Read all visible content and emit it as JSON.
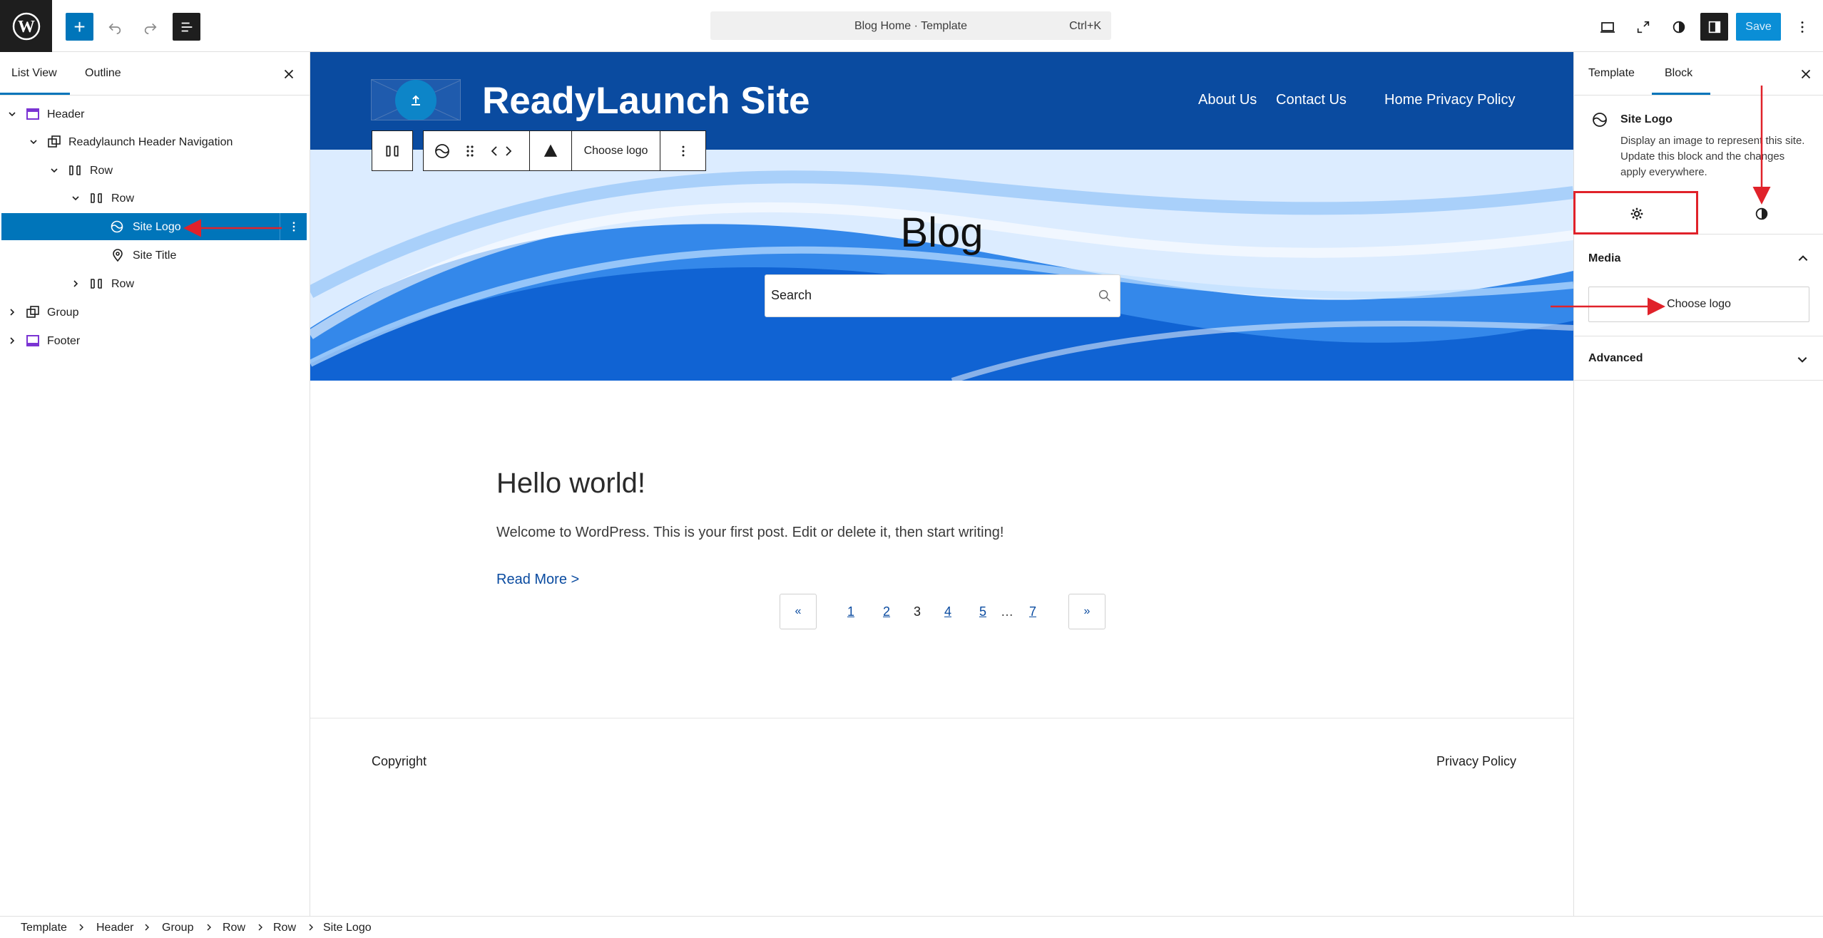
{
  "topbar": {
    "add_label": "+",
    "command_title": "Blog Home · Template",
    "command_shortcut": "Ctrl+K",
    "save_label": "Save"
  },
  "left_panel": {
    "tabs": [
      "List View",
      "Outline"
    ],
    "tree": [
      {
        "label": "Header",
        "icon": "template-part-icon",
        "level": 0,
        "expanded": true
      },
      {
        "label": "Readylaunch Header Navigation",
        "icon": "group-icon",
        "level": 1,
        "expanded": true
      },
      {
        "label": "Row",
        "icon": "row-icon",
        "level": 2,
        "expanded": true
      },
      {
        "label": "Row",
        "icon": "row-icon",
        "level": 3,
        "expanded": true
      },
      {
        "label": "Site Logo",
        "icon": "site-logo-icon",
        "level": 4,
        "selected": true
      },
      {
        "label": "Site Title",
        "icon": "map-pin-icon",
        "level": 4
      },
      {
        "label": "Row",
        "icon": "row-icon",
        "level": 3,
        "expanded": false
      },
      {
        "label": "Group",
        "icon": "group-icon",
        "level": 0,
        "expanded": false
      },
      {
        "label": "Footer",
        "icon": "template-part-icon",
        "level": 0,
        "expanded": false
      }
    ]
  },
  "canvas": {
    "site_title": "ReadyLaunch Site",
    "nav": [
      "About Us",
      "Contact Us",
      "Home",
      "Privacy Policy"
    ],
    "toolbar": {
      "choose_logo": "Choose logo"
    },
    "hero_title": "Blog",
    "search_placeholder": "Search",
    "post": {
      "title": "Hello world!",
      "excerpt": "Welcome to WordPress. This is your first post. Edit or delete it, then start writing!",
      "read_more": "Read More >"
    },
    "pagination": {
      "prev": "«",
      "next": "»",
      "pages": [
        "1",
        "2",
        "3",
        "4",
        "5",
        "…",
        "7"
      ],
      "current": "3"
    },
    "footer": {
      "copyright": "Copyright",
      "privacy": "Privacy Policy"
    }
  },
  "right_panel": {
    "tabs": [
      "Template",
      "Block"
    ],
    "active_tab": "Block",
    "block_card": {
      "title": "Site Logo",
      "description": "Display an image to represent this site. Update this block and the changes apply everywhere."
    },
    "media": {
      "title": "Media",
      "choose_logo": "Choose logo"
    },
    "advanced": {
      "title": "Advanced"
    }
  },
  "breadcrumb": [
    "Template",
    "Header",
    "Group",
    "Row",
    "Row",
    "Site Logo"
  ],
  "colors": {
    "accent": "#0075ba",
    "header_bg": "#0a4ba0",
    "annotation": "#e0222a"
  }
}
